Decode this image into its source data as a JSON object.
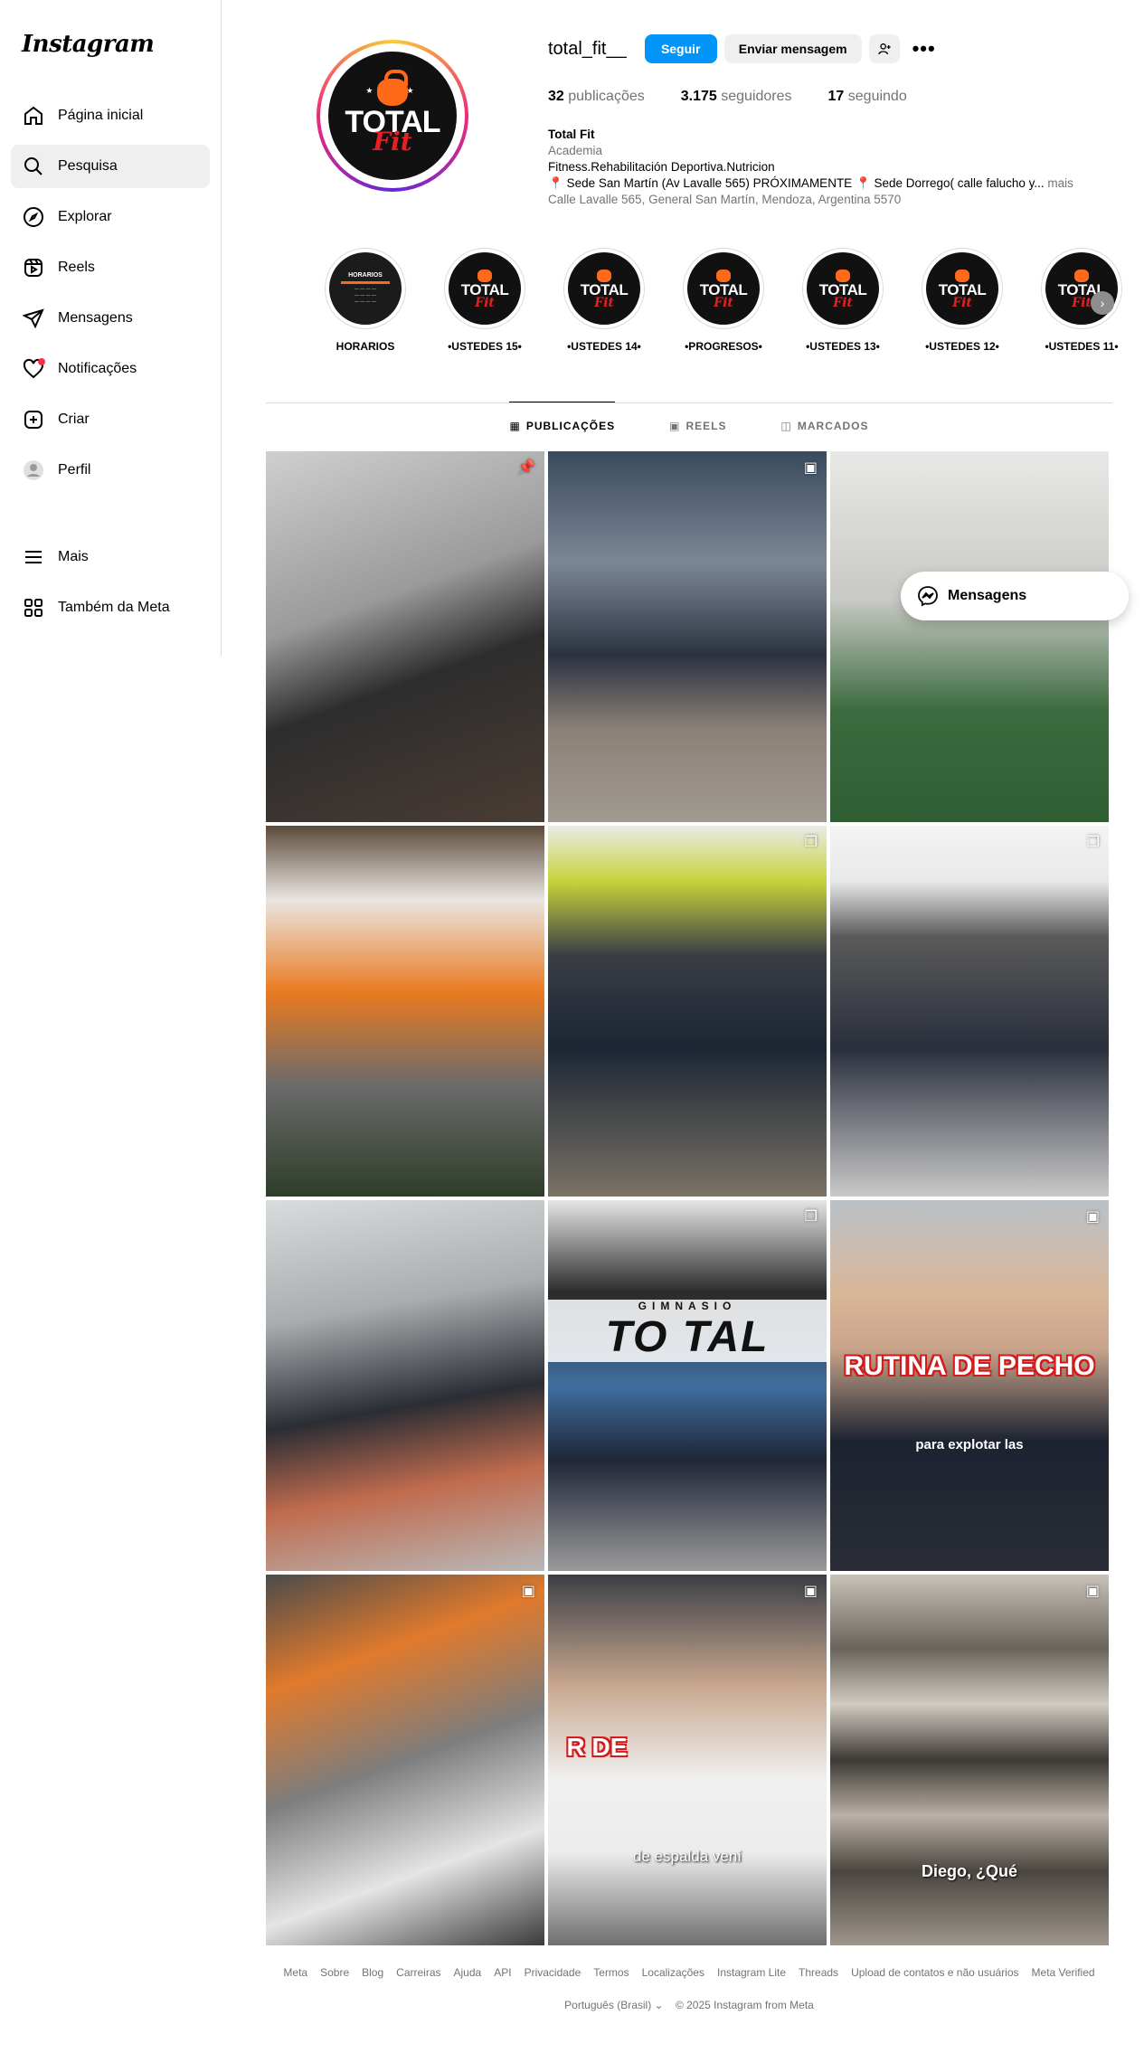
{
  "app": {
    "logo_text": "Instagram"
  },
  "sidebar": {
    "items": [
      {
        "label": "Página inicial",
        "icon": "home-icon"
      },
      {
        "label": "Pesquisa",
        "icon": "search-icon",
        "active": true
      },
      {
        "label": "Explorar",
        "icon": "compass-icon"
      },
      {
        "label": "Reels",
        "icon": "reels-icon"
      },
      {
        "label": "Mensagens",
        "icon": "send-icon"
      },
      {
        "label": "Notificações",
        "icon": "heart-icon",
        "dot": true
      },
      {
        "label": "Criar",
        "icon": "plus-square-icon"
      },
      {
        "label": "Perfil",
        "icon": "avatar-icon"
      }
    ],
    "bottom": [
      {
        "label": "Mais",
        "icon": "menu-icon"
      },
      {
        "label": "Também da Meta",
        "icon": "meta-apps-icon"
      }
    ]
  },
  "profile": {
    "username": "total_fit__",
    "follow_label": "Seguir",
    "message_label": "Enviar mensagem",
    "avatar_text_1": "TOTAL",
    "avatar_text_2": "Fit",
    "stats": {
      "posts_count": "32",
      "posts_label": "publicações",
      "followers_count": "3.175",
      "followers_label": "seguidores",
      "following_count": "17",
      "following_label": "seguindo"
    },
    "bio": {
      "name": "Total Fit",
      "category": "Academia",
      "line1": "Fitness.Rehabilitación Deportiva.Nutricion",
      "line2": "📍 Sede San Martín (Av Lavalle 565) PRÓXIMAMENTE 📍 Sede Dorrego( calle falucho y...",
      "more": " mais",
      "address": "Calle Lavalle 565, General San Martín, Mendoza, Argentina 5570"
    }
  },
  "highlights": [
    {
      "label": "HORARIOS",
      "type": "schedule",
      "hd": "HORARIOS"
    },
    {
      "label": "•USTEDES 15•"
    },
    {
      "label": "•USTEDES 14•"
    },
    {
      "label": "•PROGRESOS•"
    },
    {
      "label": "•USTEDES 13•"
    },
    {
      "label": "•USTEDES 12•"
    },
    {
      "label": "•USTEDES 11•"
    }
  ],
  "highlight_logo": {
    "a": "TOTAL",
    "b": "Fit"
  },
  "tabs": [
    {
      "label": "PUBLICAÇÕES",
      "icon": "grid-icon",
      "active": true
    },
    {
      "label": "REELS",
      "icon": "reels-icon"
    },
    {
      "label": "MARCADOS",
      "icon": "tagged-icon"
    }
  ],
  "posts": [
    {
      "badge": "📌",
      "badge_icon": "pin-icon"
    },
    {
      "badge": "▣",
      "badge_icon": "reel-icon"
    },
    {
      "badge": "",
      "badge_icon": ""
    },
    {
      "badge": "",
      "badge_icon": ""
    },
    {
      "badge": "❐",
      "badge_icon": "carousel-icon"
    },
    {
      "badge": "❐",
      "badge_icon": "carousel-icon"
    },
    {
      "badge": "",
      "badge_icon": ""
    },
    {
      "badge": "❐",
      "badge_icon": "carousel-icon",
      "sign": "TO TAL",
      "sign_small": "GIMNASIO"
    },
    {
      "badge": "▣",
      "badge_icon": "reel-icon",
      "caption": "RUTINA DE PECHO",
      "caption2": "para explotar las"
    },
    {
      "badge": "▣",
      "badge_icon": "reel-icon"
    },
    {
      "badge": "▣",
      "badge_icon": "reel-icon",
      "caption": "R DE",
      "caption2": "de espalda vení"
    },
    {
      "badge": "▣",
      "badge_icon": "reel-icon",
      "caption2": "Diego, ¿Qué"
    }
  ],
  "messages_float": {
    "label": "Mensagens"
  },
  "footer": {
    "links": [
      "Meta",
      "Sobre",
      "Blog",
      "Carreiras",
      "Ajuda",
      "API",
      "Privacidade",
      "Termos",
      "Localizações",
      "Instagram Lite",
      "Threads",
      "Upload de contatos e não usuários",
      "Meta Verified"
    ],
    "language": "Português (Brasil)",
    "copyright": "© 2025 Instagram from Meta"
  }
}
